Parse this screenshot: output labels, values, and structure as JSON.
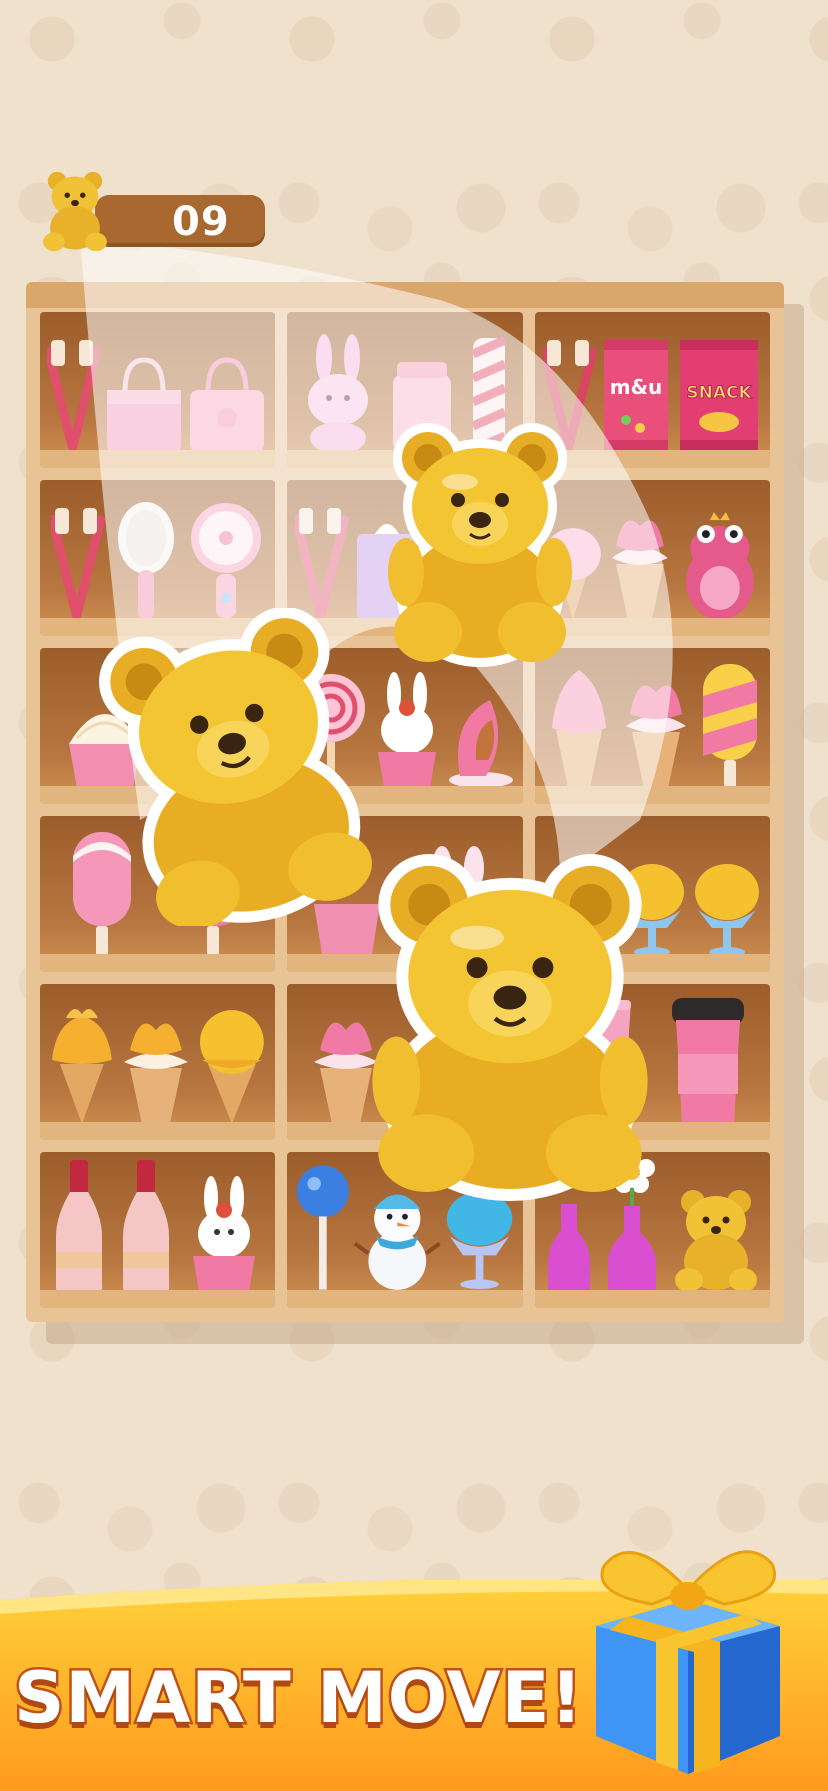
{
  "hud": {
    "target_item_icon": "gold-bear-icon",
    "remaining_count": "09"
  },
  "banner": {
    "title": "SMART MOVE!",
    "gift_icon": "gift-box-icon"
  },
  "shelf": {
    "rows": [
      [
        "toothbrushes, pink handbag, pink handbag",
        "pink bunny, jar, striped candy",
        "toothbrushes, m&u candy bag, snack bag"
      ],
      [
        "toothbrushes, hair brush, hand fan",
        "toothbrushes, tissue box",
        "ice cream cone, ice cream cone, pink frog"
      ],
      [
        "cupcake, cupcake",
        "lollipop, bunny cupcake, jelly slice",
        "ice cream cone, ice cream cone, popsicle"
      ],
      [
        "popsicle, popsicle",
        "cupcake, pop-it toy",
        "lemon sundae, lemon sundae, lemon sundae"
      ],
      [
        "ice cream cone, ice cream cone, ice cream cone",
        "ice cream cone, ice cream cone",
        "pink cup, pink coffee cup"
      ],
      [
        "pink bottle, pink bottle, bunny cupcake",
        "blue lollipop, snowman, blue sundae",
        "pink vase, pink vase, gold bear"
      ]
    ],
    "collected_item": "gold bear",
    "colors": {
      "wood_light": "#e7c396",
      "wood_dark": "#9c5d2c",
      "pink": "#f07aa3",
      "gold": "#e9b52a"
    }
  },
  "snack_label": "SNACK",
  "candy_label": "m&u"
}
